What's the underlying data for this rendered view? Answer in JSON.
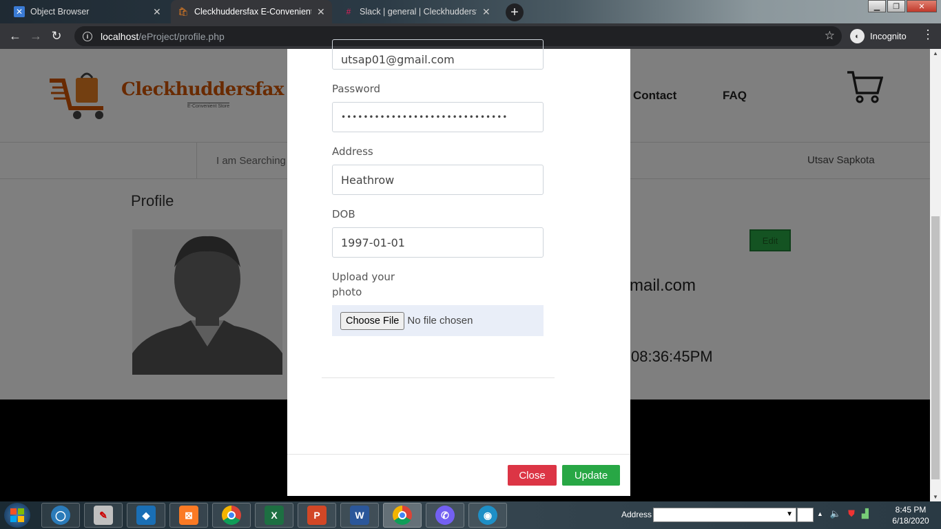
{
  "browser": {
    "tabs": [
      {
        "title": "Object Browser",
        "icon": "object-browser-icon"
      },
      {
        "title": "Cleckhuddersfax E-Convenient St",
        "icon": "site-favicon-icon"
      },
      {
        "title": "Slack | general | Cleckhuddersfax",
        "icon": "slack-icon"
      }
    ],
    "url_host": "localhost",
    "url_path": "/eProject/profile.php",
    "incognito_label": "Incognito"
  },
  "site": {
    "logo_name": "Cleckhuddersfax",
    "logo_tagline": "E-Convenient Store",
    "nav": {
      "contact": "Contact",
      "faq": "FAQ"
    },
    "search_placeholder": "I am Searching",
    "username": "Utsav Sapkota",
    "profile_title": "Profile",
    "edit_label": "Edit",
    "email_fragment": "mail.com",
    "time_fragment": "08:36:45PM"
  },
  "modal": {
    "email_value": "utsap01@gmail.com",
    "password_label": "Password",
    "password_dots": "••••••••••••••••••••••••••••••",
    "address_label": "Address",
    "address_value": "Heathrow",
    "dob_label": "DOB",
    "dob_value": "1997-01-01",
    "upload_label_1": "Upload your",
    "upload_label_2": "photo",
    "choose_file": "Choose File",
    "no_file": "No file chosen",
    "close_label": "Close",
    "update_label": "Update"
  },
  "taskbar": {
    "address_label": "Address",
    "time": "8:45 PM",
    "date": "6/18/2020"
  },
  "colors": {
    "close_button": "#dc3545",
    "update_button": "#28a745",
    "logo_orange": "#d35400",
    "chrome_dark": "#35363a"
  }
}
